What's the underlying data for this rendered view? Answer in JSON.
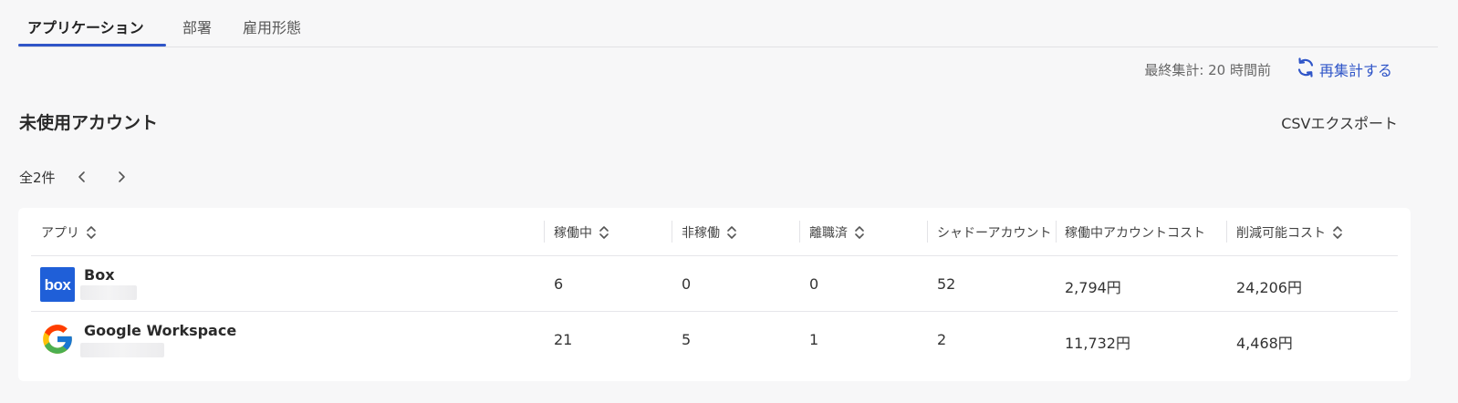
{
  "tabs": [
    {
      "label": "アプリケーション",
      "active": true
    },
    {
      "label": "部署",
      "active": false
    },
    {
      "label": "雇用形態",
      "active": false
    }
  ],
  "header": {
    "last_aggregated": "最終集計: 20 時間前",
    "recalc_label": "再集計する"
  },
  "section": {
    "title": "未使用アカウント",
    "csv_export_label": "CSVエクスポート",
    "count_label": "全2件"
  },
  "table": {
    "columns": [
      "アプリ",
      "稼働中",
      "非稼働",
      "離職済",
      "シャドーアカウント",
      "稼働中アカウントコスト",
      "削減可能コスト"
    ],
    "rows": [
      {
        "app": "Box",
        "icon": "box-logo-icon",
        "active": "6",
        "inactive": "0",
        "left": "0",
        "shadow": "52",
        "active_cost": "2,794円",
        "savable_cost": "24,206円"
      },
      {
        "app": "Google Workspace",
        "icon": "google-logo-icon",
        "active": "21",
        "inactive": "5",
        "left": "1",
        "shadow": "2",
        "active_cost": "11,732円",
        "savable_cost": "4,468円"
      }
    ]
  },
  "colors": {
    "accent": "#2f55c8",
    "box_brand": "#1f5fd8",
    "background": "#f7f7f8",
    "card": "#ffffff"
  }
}
